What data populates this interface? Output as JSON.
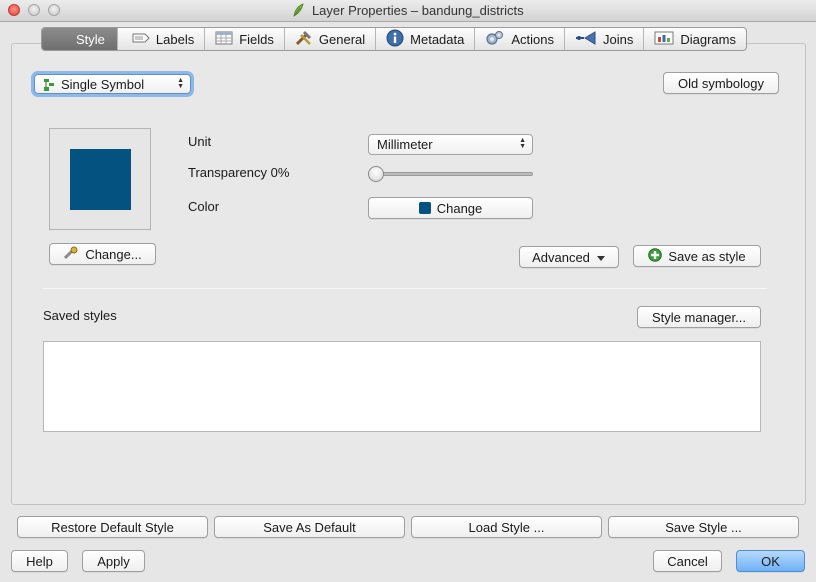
{
  "window": {
    "title": "Layer Properties – bandung_districts"
  },
  "tabs": [
    {
      "label": "Style",
      "icon": "style-icon"
    },
    {
      "label": "Labels",
      "icon": "labels-icon"
    },
    {
      "label": "Fields",
      "icon": "fields-icon"
    },
    {
      "label": "General",
      "icon": "general-icon"
    },
    {
      "label": "Metadata",
      "icon": "metadata-icon"
    },
    {
      "label": "Actions",
      "icon": "actions-icon"
    },
    {
      "label": "Joins",
      "icon": "joins-icon"
    },
    {
      "label": "Diagrams",
      "icon": "diagrams-icon"
    }
  ],
  "style": {
    "renderer_select": "Single Symbol",
    "old_symbology_label": "Old symbology",
    "symbol_color": "#04527f",
    "unit_label": "Unit",
    "unit_value": "Millimeter",
    "transparency_label": "Transparency 0%",
    "transparency_value": 0,
    "color_label": "Color",
    "color_change_label": "Change",
    "change_symbol_label": "Change...",
    "advanced_label": "Advanced",
    "save_as_style_label": "Save as style",
    "saved_styles_label": "Saved styles",
    "style_manager_label": "Style manager..."
  },
  "footer": {
    "restore_default_label": "Restore Default Style",
    "save_as_default_label": "Save As Default",
    "load_style_label": "Load Style ...",
    "save_style_label": "Save Style ...",
    "help_label": "Help",
    "apply_label": "Apply",
    "cancel_label": "Cancel",
    "ok_label": "OK"
  }
}
